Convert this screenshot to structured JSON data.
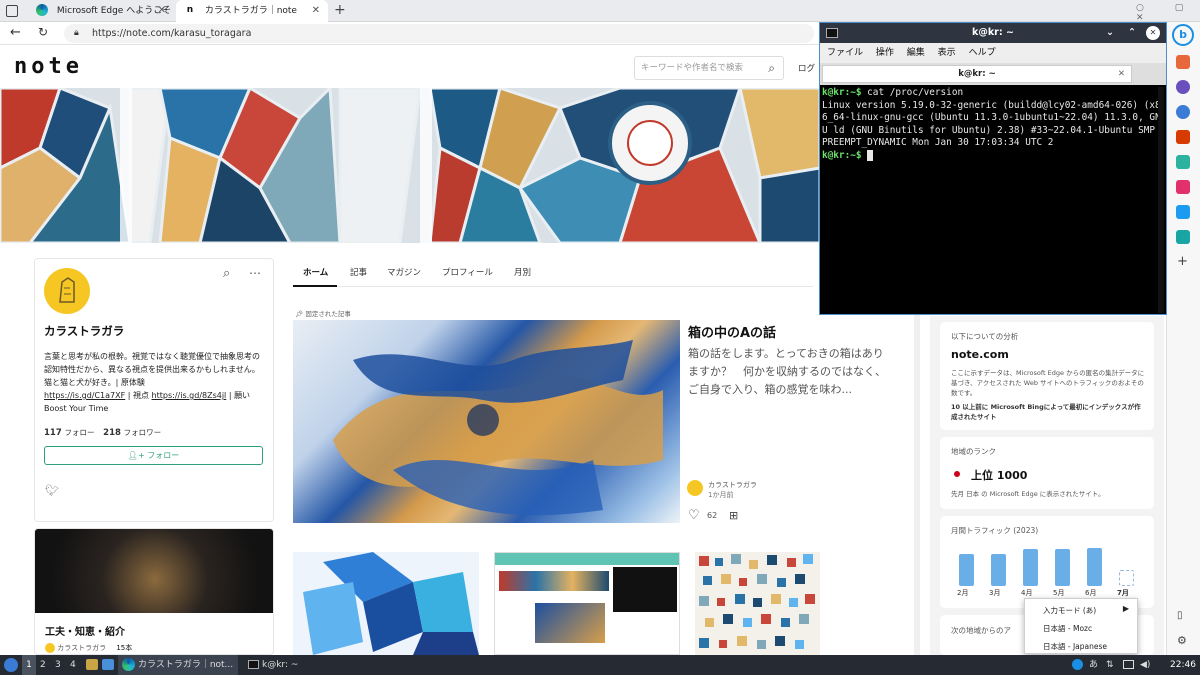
{
  "browser": {
    "tabs": [
      {
        "label": "Microsoft Edge へようこそ",
        "active": false
      },
      {
        "label": "カラストラガラ｜note",
        "active": true
      }
    ],
    "url": "https://note.com/karasu_toragara"
  },
  "note": {
    "logo": "note",
    "search_placeholder": "キーワードや作者名で検索",
    "login": "ログ",
    "profile": {
      "name": "カラストラガラ",
      "bio": "言葉と思考が私の根幹。視覚ではなく聴覚優位で抽象思考の認知特性だから、異なる視点を提供出来るかもしれません。猫と猫と犬が好き。| 原体験",
      "link1": "https://is.gd/C1a7XF",
      "link_sep": " | 視点 ",
      "link2": "https://is.gd/8Zs4jl",
      "link_tail": " | 願い",
      "boost": "Boost Your Time",
      "follow_count": "117",
      "follow_label": "フォロー",
      "follower_count": "218",
      "follower_label": "フォロワー",
      "follow_button": "フォロー"
    },
    "tabs": [
      "ホーム",
      "記事",
      "マガジン",
      "プロフィール",
      "月別"
    ],
    "pinned_label": "固定された記事",
    "featured": {
      "title": "箱の中のAの話",
      "desc": "箱の話をします。とっておきの箱はありますか？　何かを収納するのではなく、ご自身で入り、箱の感覚を味わ...",
      "author": "カラストラガラ",
      "time": "1か月前",
      "likes": "62"
    },
    "magazine": {
      "title": "工夫・知恵・紹介",
      "author": "カラストラガラ",
      "count": "15本"
    }
  },
  "sidebar": {
    "analysis_label": "以下についての分析",
    "site": "note.com",
    "site_desc": "ここに示すデータは、Microsoft Edge からの匿名の集計データに基づき、アクセスされた Web サイトへのトラフィックのおよその数です。",
    "index_note": "10 以上前に Microsoft Bingによって最初にインデックスが作成されたサイト",
    "rank_label": "地域のランク",
    "rank_value": "上位 1000",
    "rank_desc": "先月 日本 の Microsoft Edge に表示されたサイト。",
    "traffic_label": "月間トラフィック (2023)",
    "traffic_months": [
      "2月",
      "3月",
      "4月",
      "5月",
      "6月",
      "7月"
    ],
    "traffic_values": [
      0.8,
      0.8,
      0.92,
      0.92,
      0.96,
      0
    ],
    "region_label": "次の地域からのア"
  },
  "terminal": {
    "title": "k@kr: ~",
    "menu": [
      "ファイル",
      "操作",
      "編集",
      "表示",
      "ヘルプ"
    ],
    "tab_title": "k@kr: ~",
    "prompt": "k@kr:~$",
    "command": " cat /proc/version",
    "output": "Linux version 5.19.0-32-generic (buildd@lcy02-amd64-026) (x86_64-linux-gnu-gcc (Ubuntu 11.3.0-1ubuntu1~22.04) 11.3.0, GNU ld (GNU Binutils for Ubuntu) 2.38) #33~22.04.1-Ubuntu SMP PREEMPT_DYNAMIC Mon Jan 30 17:03:34 UTC 2",
    "prompt2": "k@kr:~$"
  },
  "ime_menu": {
    "items": [
      "入力モード (あ)",
      "日本語 - Mozc",
      "日本語 - Japanese"
    ]
  },
  "taskbar": {
    "workspaces": [
      "1",
      "2",
      "3",
      "4"
    ],
    "apps": [
      "カラストラガラ｜not...",
      "k@kr: ~"
    ],
    "time": "22:46"
  },
  "colors": {
    "accent": "#2f9e7e",
    "terminal_prompt": "#6be46b",
    "edge_chart_bar": "#6aaee8"
  }
}
